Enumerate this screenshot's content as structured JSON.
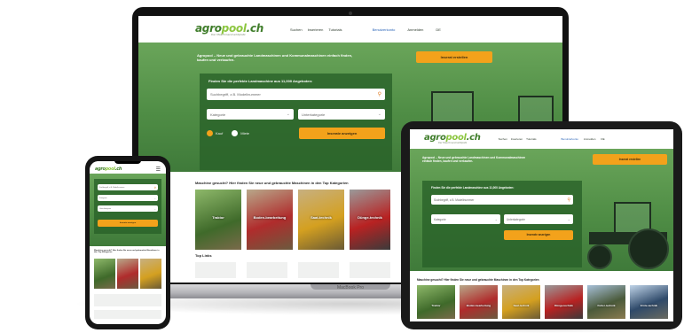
{
  "site": {
    "logo_main": "agro",
    "logo_accent": "pool",
    "logo_tld": ".ch",
    "logo_sub": "Der Maschinenmarktplatz",
    "nav": [
      "Suchen",
      "Inserieren",
      "Tutorials"
    ],
    "account": "Benutzerkonto",
    "login": "Anmelden",
    "lang": "DE",
    "hero_text": "Agropool – Neue und gebrauchte Landmaschinen und Kommunalmaschinen einfach finden, kaufen und verkaufen.",
    "cta": "Inserat erstellen",
    "panel_title": "Finden Sie die perfekte Landmaschine aus 11,000 Angeboten:",
    "search_placeholder": "Suchbegriff, z.B. Modellnummer",
    "category_placeholder": "Kategorie",
    "subcategory_placeholder": "Unterkategorie",
    "radio_buy": "Kauf",
    "radio_rent": "Miete",
    "search_button": "Inserate anzeigen",
    "section_title": "Maschine gesucht? Hier finden Sie neue und gebrauchte Maschinen in den Top Kategorien",
    "categories": [
      "Traktor",
      "Boden-bearbeitung",
      "Saat-technik",
      "Dünge-technik",
      "Futter-technik",
      "Ernte-technik"
    ],
    "top_links": "Top Links"
  },
  "device": {
    "laptop_label": "MacBook Pro"
  },
  "colors": {
    "brand_green": "#3f7d2a",
    "hero_green": "#4f8d45",
    "accent_orange": "#f3a21b"
  }
}
